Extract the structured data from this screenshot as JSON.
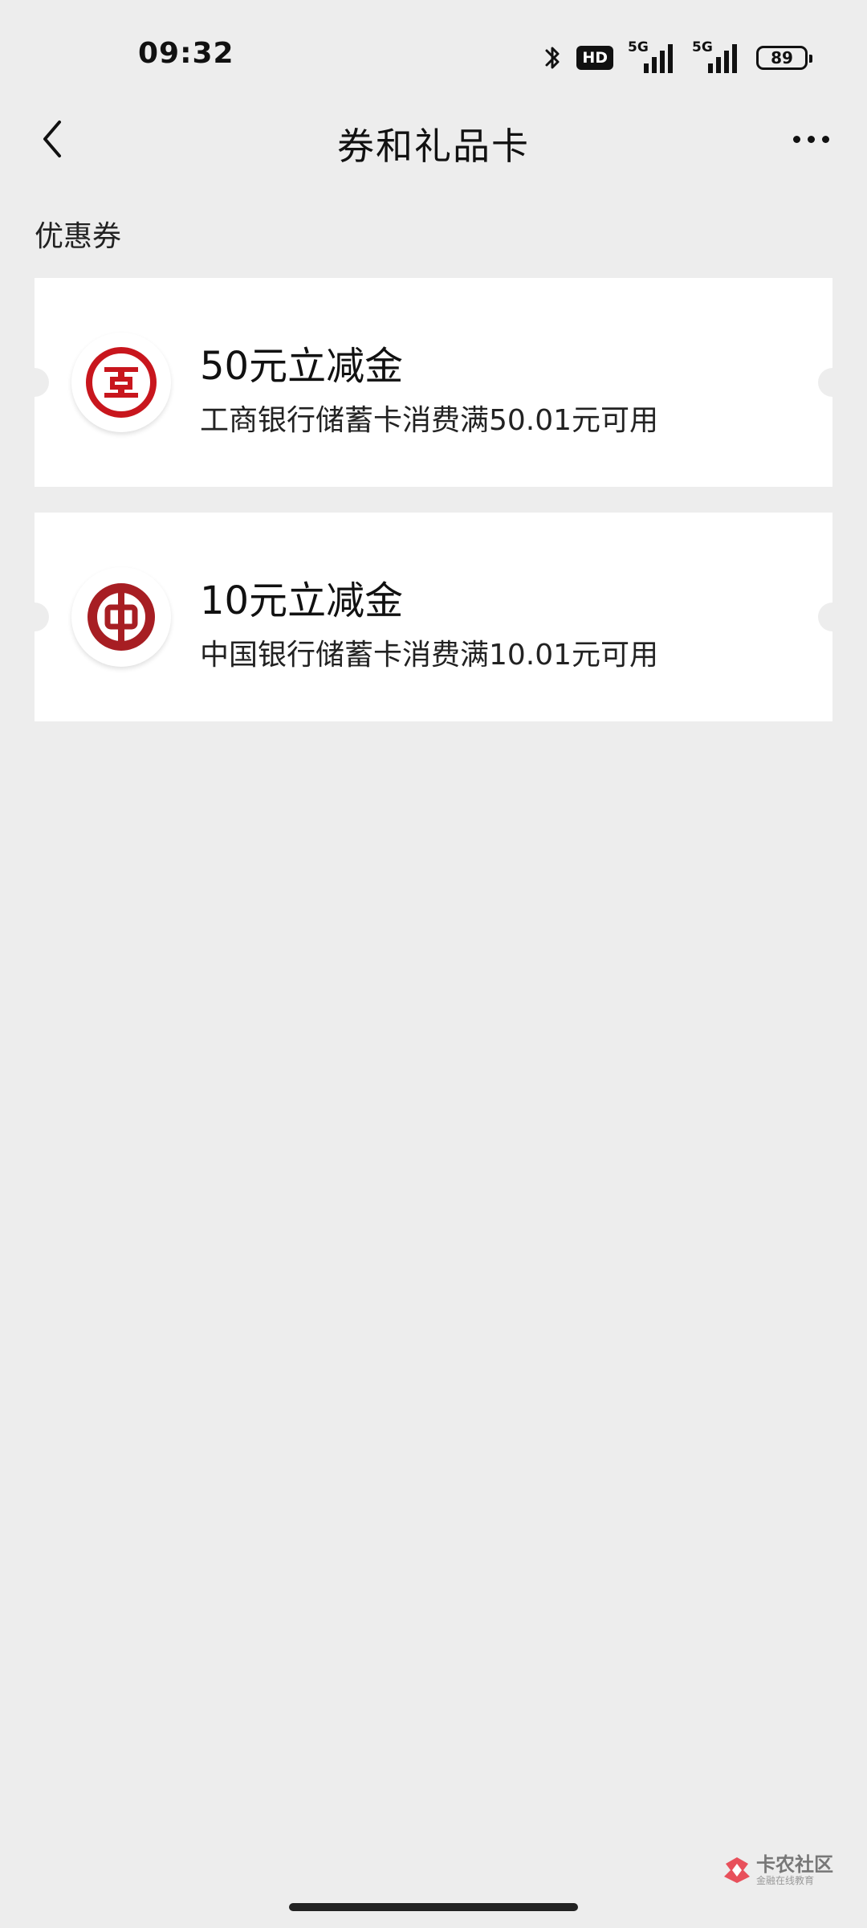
{
  "status_bar": {
    "time": "09:32",
    "hd_label": "HD",
    "network_1": "5G",
    "network_2": "5G",
    "battery": "89",
    "icons": [
      "bluetooth-icon",
      "hd-voice-icon",
      "signal-icon",
      "signal-icon",
      "battery-icon"
    ]
  },
  "nav": {
    "title": "券和礼品卡",
    "back_icon": "chevron-left-icon",
    "more_icon": "more-dots-icon"
  },
  "section": {
    "label": "优惠券"
  },
  "coupons": [
    {
      "title": "50元立减金",
      "description": "工商银行储蓄卡消费满50.01元可用",
      "logo": "icbc-logo-icon",
      "brand_color": "#c8161d"
    },
    {
      "title": "10元立减金",
      "description": "中国银行储蓄卡消费满10.01元可用",
      "logo": "boc-logo-icon",
      "brand_color": "#a71e23"
    }
  ],
  "watermark": {
    "title": "卡农社区",
    "subtitle": "金融在线教育"
  },
  "colors": {
    "background": "#ededed",
    "card": "#ffffff",
    "text": "#111111"
  }
}
